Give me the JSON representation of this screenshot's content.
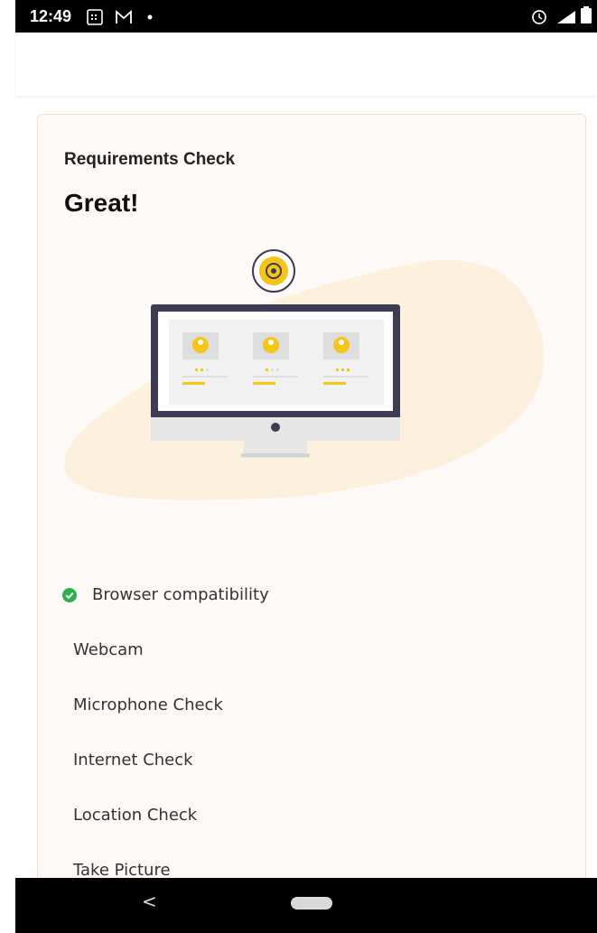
{
  "status_bar": {
    "time": "12:49",
    "left_icons": [
      "calendar-icon",
      "mail-icon",
      "dot-icon"
    ],
    "right_icons": [
      "alarm-icon",
      "signal-icon",
      "battery-icon"
    ]
  },
  "card": {
    "subtitle": "Requirements Check",
    "title": "Great!"
  },
  "illustration": {
    "name": "monitor-with-webcam-illustration",
    "colors": {
      "blob": "#fdf0dc",
      "monitor": "#3f3b55",
      "accent": "#f5c518",
      "screen": "#ffffff",
      "stand": "#e6e6e6"
    }
  },
  "checks": [
    {
      "label": "Browser compatibility",
      "passed": true
    },
    {
      "label": "Webcam",
      "passed": false
    },
    {
      "label": "Microphone Check",
      "passed": false
    },
    {
      "label": "Internet Check",
      "passed": false
    },
    {
      "label": "Location Check",
      "passed": false
    },
    {
      "label": "Take Picture",
      "passed": false
    }
  ],
  "colors": {
    "success": "#2bb04a",
    "card_bg": "#fdf9f6",
    "card_border": "#f6dcc8"
  },
  "nav_bar": {
    "back_glyph": "<"
  }
}
